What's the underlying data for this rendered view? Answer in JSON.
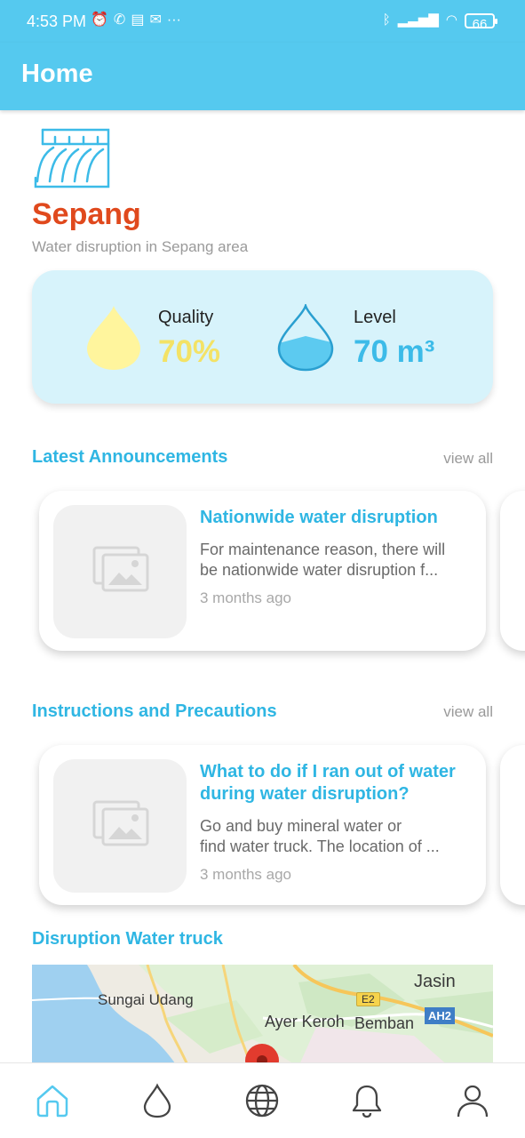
{
  "status_bar": {
    "time": "4:53 PM",
    "left_icons": [
      "alarm-icon",
      "whatsapp-icon",
      "news-icon",
      "outlook-icon",
      "more-dots-icon"
    ],
    "battery": "66"
  },
  "header": {
    "title": "Home"
  },
  "area": {
    "name": "Sepang",
    "description": "Water disruption in Sepang area"
  },
  "stats": {
    "quality": {
      "label": "Quality",
      "value": "70%",
      "level": 0.7
    },
    "level": {
      "label": "Level",
      "value": "70 m³"
    }
  },
  "announcements": {
    "title": "Latest Announcements",
    "view_all": "view all",
    "items": [
      {
        "title": "Nationwide water disruption",
        "desc_line1": "For maintenance reason, there will",
        "desc_line2": "be nationwide water disruption f...",
        "time": "3 months ago"
      }
    ]
  },
  "instructions": {
    "title": "Instructions and Precautions",
    "view_all": "view all",
    "items": [
      {
        "title": "What to do if I ran out of water during water disruption?",
        "desc_line1": "Go and buy mineral water or",
        "desc_line2": "find water truck. The location of ...",
        "time": "3 months ago"
      }
    ]
  },
  "map": {
    "title": "Disruption Water truck",
    "labels": {
      "jasin": "Jasin",
      "sungai_udang": "Sungai Udang",
      "ayer_keroh": "Ayer Keroh",
      "bemban": "Bemban",
      "e2": "E2",
      "ah2": "AH2"
    }
  },
  "bottom_nav": [
    "home-icon",
    "water-drop-icon",
    "globe-icon",
    "bell-icon",
    "person-icon"
  ],
  "colors": {
    "primary": "#55c9ef",
    "accent_text": "#2fb6e3",
    "area_name": "#e0491d",
    "quality": "#f3e266",
    "card_bg": "#d7f3fb"
  }
}
